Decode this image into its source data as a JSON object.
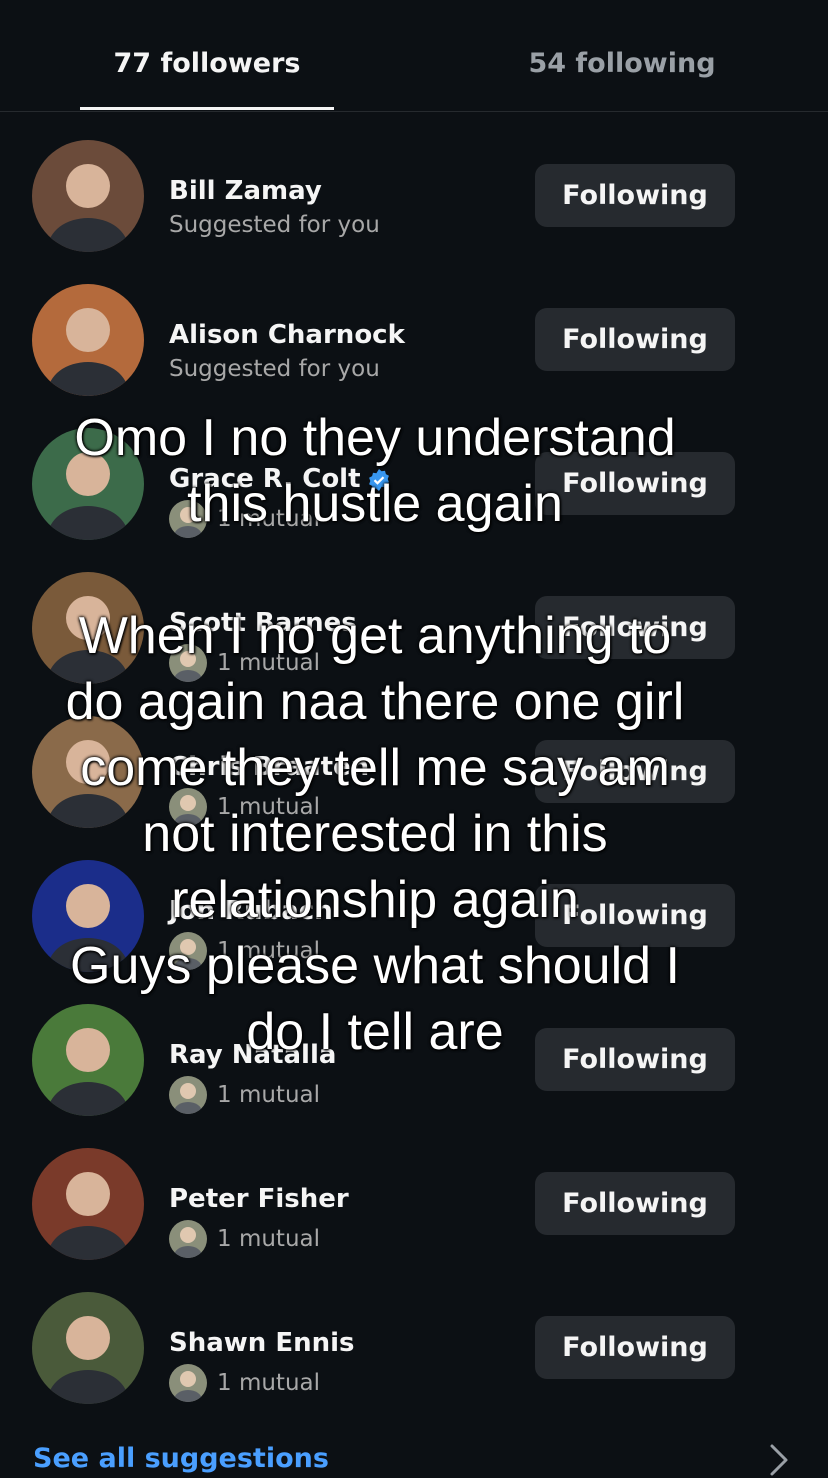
{
  "tabs": {
    "followers_label": "77 followers",
    "following_label": "54 following"
  },
  "users": [
    {
      "name": "Bill Zamay",
      "subtitle": "Suggested for you",
      "button": "Following",
      "avatar_color": "#6b4b3a"
    },
    {
      "name": "Alison Charnock",
      "subtitle": "Suggested for you",
      "button": "Following",
      "avatar_color": "#b46a3c"
    },
    {
      "name": "Grace R. Colt",
      "subtitle": "1 mutual",
      "button": "Following",
      "avatar_color": "#3c6b4a"
    },
    {
      "name": "Scott Barnes",
      "subtitle": "1 mutual",
      "button": "Following",
      "avatar_color": "#7a5a3a"
    },
    {
      "name": "Chris Braaten",
      "subtitle": "1 mutual",
      "button": "Following",
      "avatar_color": "#8a6a4a"
    },
    {
      "name": "Jon Rubach",
      "subtitle": "1 mutual",
      "button": "Following",
      "avatar_color": "#1b2d8a"
    },
    {
      "name": "Ray Natalla",
      "subtitle": "1 mutual",
      "button": "Following",
      "avatar_color": "#4a7a3a"
    },
    {
      "name": "Peter Fisher",
      "subtitle": "1 mutual",
      "button": "Following",
      "avatar_color": "#7a3a2a"
    },
    {
      "name": "Shawn Ennis",
      "subtitle": "1 mutual",
      "button": "Following",
      "avatar_color": "#4a5a3a"
    }
  ],
  "footer": {
    "see_all_label": "See all suggestions"
  },
  "overlay_text": "Omo I no they understand\nthis hustle again\n\nWhen I no get anything to\ndo again naa there one girl\ncome they tell me say am\nnot interested in this\nrelationship again\nGuys please what should I\ndo I tell are",
  "colors": {
    "background": "#0c1014",
    "button_bg": "#262a2f",
    "link": "#4a9fff",
    "verified": "#3897f0"
  }
}
